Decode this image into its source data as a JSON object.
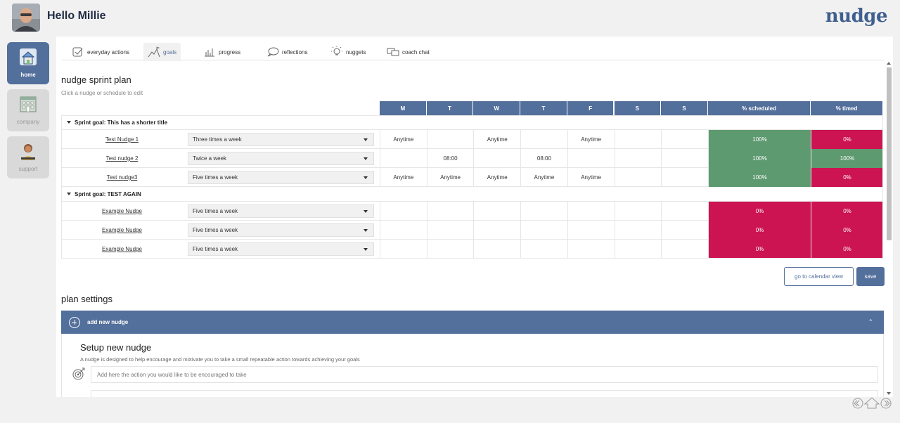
{
  "header": {
    "greeting": "Hello Millie",
    "logo": "nudge"
  },
  "sidebar": {
    "items": [
      {
        "label": "home",
        "icon": "home-icon",
        "active": true
      },
      {
        "label": "company",
        "icon": "building-icon",
        "active": false
      },
      {
        "label": "support",
        "icon": "support-person-icon",
        "active": false
      }
    ]
  },
  "tabs": [
    {
      "label": "everyday actions",
      "icon": "checklist-icon",
      "active": false
    },
    {
      "label": "goals",
      "icon": "mountain-flag-icon",
      "active": true
    },
    {
      "label": "progress",
      "icon": "progress-chart-icon",
      "active": false
    },
    {
      "label": "reflections",
      "icon": "speech-bubble-icon",
      "active": false
    },
    {
      "label": "nuggets",
      "icon": "lightbulb-icon",
      "active": false
    },
    {
      "label": "coach chat",
      "icon": "chat-bubbles-icon",
      "active": false
    }
  ],
  "plan": {
    "title": "nudge sprint plan",
    "subtitle": "Click a nudge or schedule to edit",
    "columns": [
      "M",
      "T",
      "W",
      "T",
      "F",
      "S",
      "S",
      "% scheduled",
      "% timed"
    ],
    "groups": [
      {
        "label": "Sprint goal: This has a shorter title",
        "rows": [
          {
            "name": "Test Nudge 1",
            "freq": "Three times a week",
            "days": [
              "Anytime",
              "",
              "Anytime",
              "",
              "Anytime",
              "",
              ""
            ],
            "scheduled": "100%",
            "timed": "0%",
            "sched_ok": true,
            "timed_ok": false
          },
          {
            "name": "Test nudge 2",
            "freq": "Twice a week",
            "days": [
              "",
              "08:00",
              "",
              "08:00",
              "",
              "",
              ""
            ],
            "scheduled": "100%",
            "timed": "100%",
            "sched_ok": true,
            "timed_ok": true
          },
          {
            "name": "Test nudge3",
            "freq": "Five times a week",
            "days": [
              "Anytime",
              "Anytime",
              "Anytime",
              "Anytime",
              "Anytime",
              "",
              ""
            ],
            "scheduled": "100%",
            "timed": "0%",
            "sched_ok": true,
            "timed_ok": false
          }
        ]
      },
      {
        "label": "Sprint goal: TEST AGAIN",
        "rows": [
          {
            "name": "Example Nudge",
            "freq": "Five times a week",
            "days": [
              "",
              "",
              "",
              "",
              "",
              "",
              ""
            ],
            "scheduled": "0%",
            "timed": "0%",
            "sched_ok": false,
            "timed_ok": false
          },
          {
            "name": "Example Nudge",
            "freq": "Five times a week",
            "days": [
              "",
              "",
              "",
              "",
              "",
              "",
              ""
            ],
            "scheduled": "0%",
            "timed": "0%",
            "sched_ok": false,
            "timed_ok": false
          },
          {
            "name": "Example Nudge",
            "freq": "Five times a week",
            "days": [
              "",
              "",
              "",
              "",
              "",
              "",
              ""
            ],
            "scheduled": "0%",
            "timed": "0%",
            "sched_ok": false,
            "timed_ok": false
          }
        ]
      }
    ],
    "calendar_button": "go to calendar view",
    "save_button": "save"
  },
  "settings": {
    "title": "plan settings",
    "accordion_label": "add new nudge",
    "setup_title": "Setup new nudge",
    "setup_subtitle": "A nudge is designed to help encourage and motivate you to take a small repeatable action towards achieving your goals",
    "action_placeholder": "Add here the action you would like to be encouraged to take"
  },
  "colors": {
    "accent": "#536f9b",
    "good": "#5e9a70",
    "bad": "#cc1452"
  }
}
